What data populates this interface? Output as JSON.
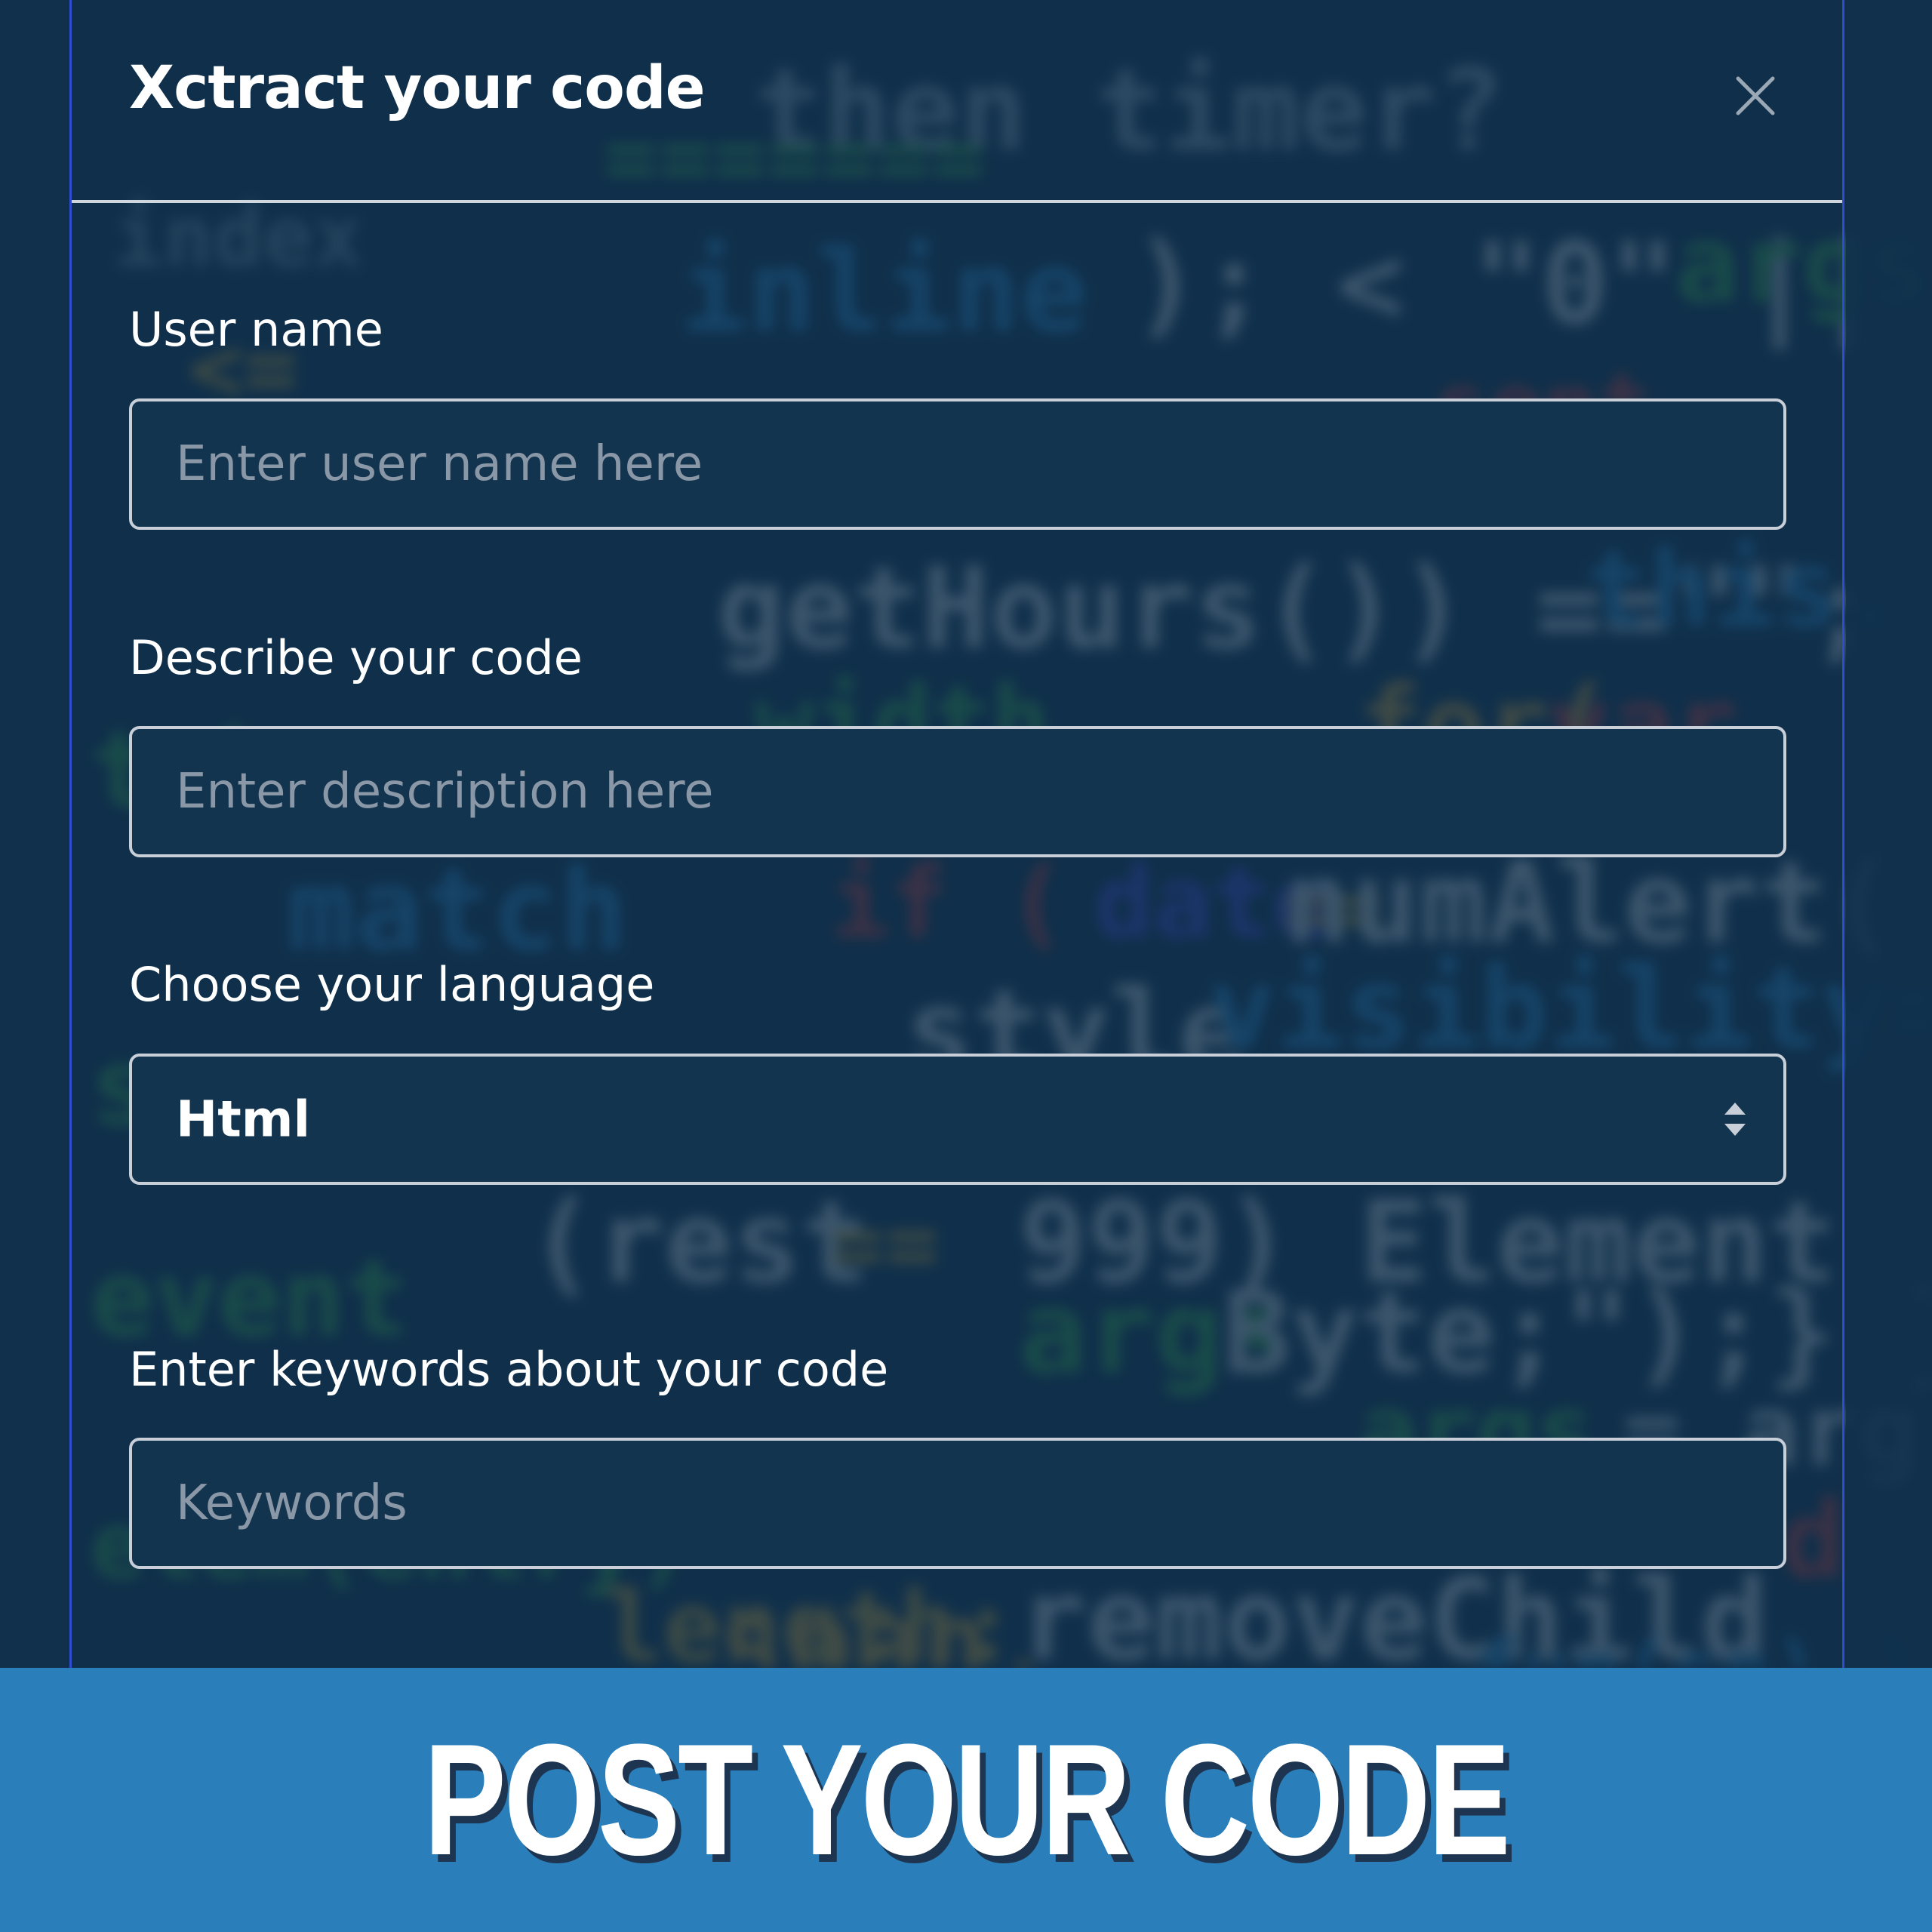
{
  "modal": {
    "title": "Xctract your code"
  },
  "form": {
    "username": {
      "label": "User name",
      "placeholder": "Enter user name here",
      "value": ""
    },
    "description": {
      "label": "Describe your code",
      "placeholder": "Enter description here",
      "value": ""
    },
    "language": {
      "label": "Choose your language",
      "selected": "Html"
    },
    "keywords": {
      "label": "Enter keywords about your code",
      "placeholder": "Keywords",
      "value": ""
    }
  },
  "banner": {
    "title": "POST YOUR CODE"
  },
  "icons": {
    "close": "close-icon",
    "select": "select-arrows-icon"
  },
  "colors": {
    "background": "#12324d",
    "input_border": "#c8cfd8",
    "placeholder": "#8a97a6",
    "modal_border": "#2f4ecf",
    "banner": "#2a7fbb",
    "banner_shadow": "#1d3550"
  }
}
